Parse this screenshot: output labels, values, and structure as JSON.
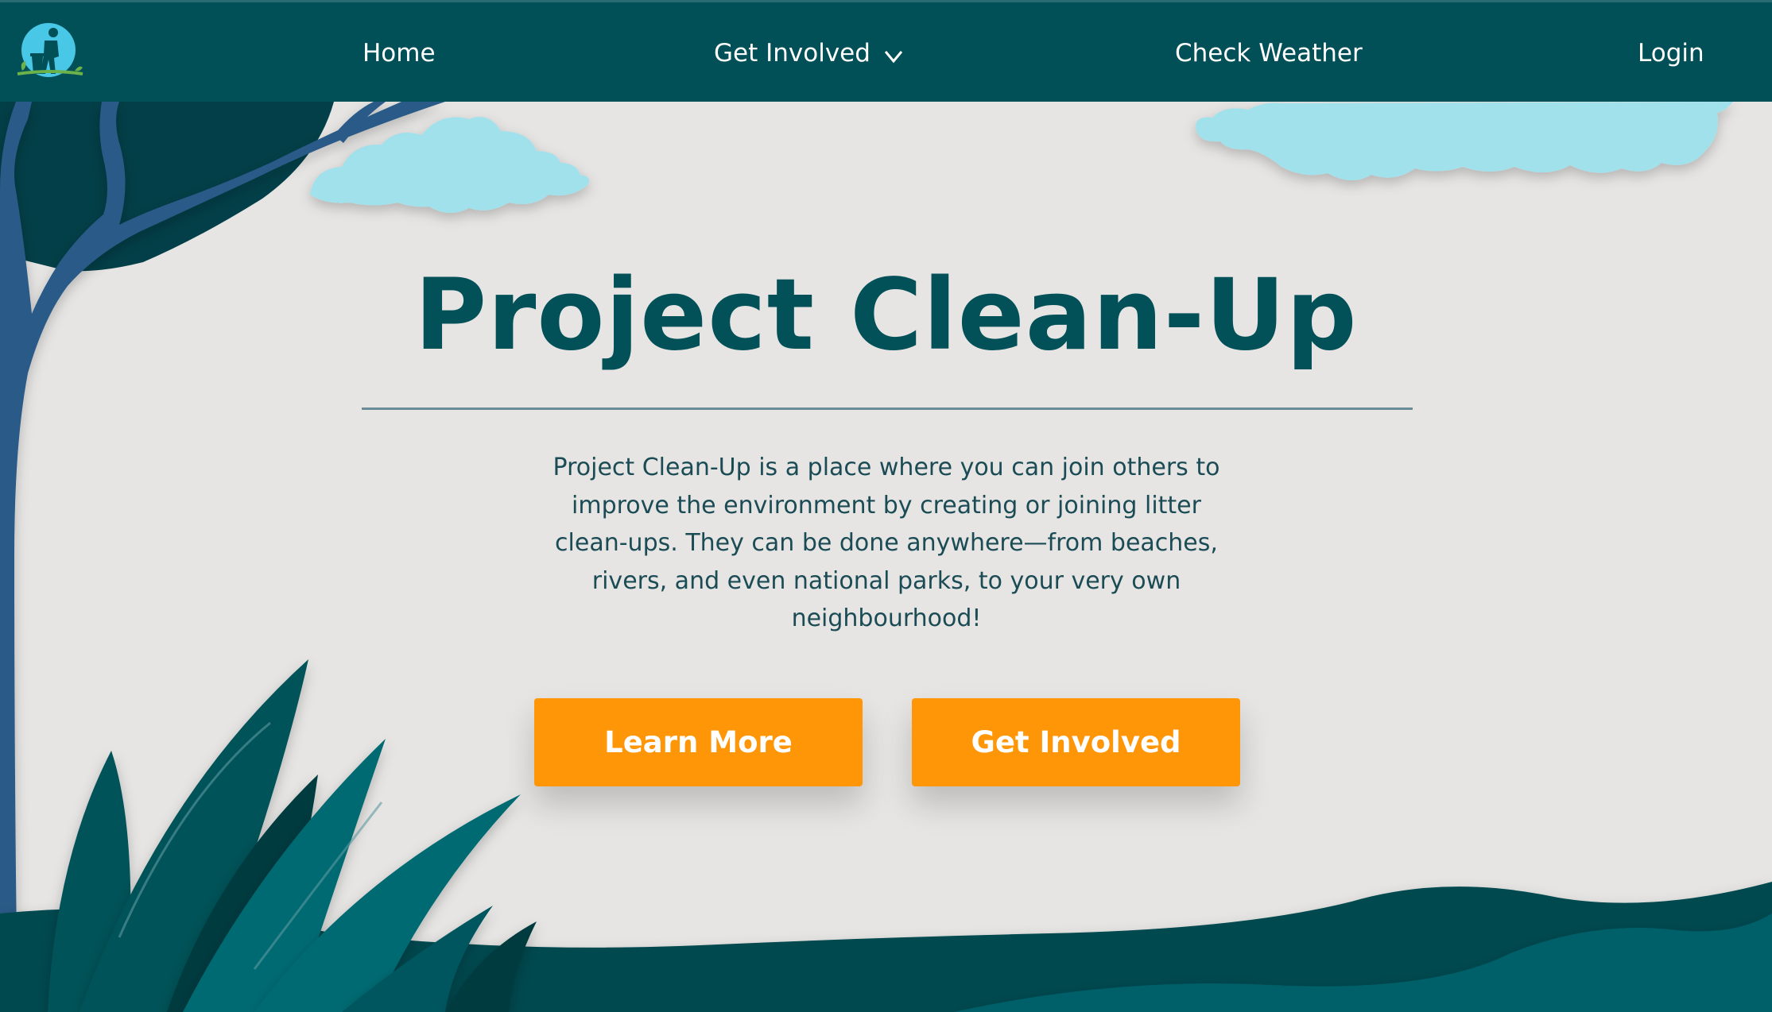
{
  "nav": {
    "logo_icon": "person-with-trash-bin-logo",
    "links": [
      {
        "label": "Home"
      },
      {
        "label": "Get Involved",
        "icon": "chevron-down-icon"
      },
      {
        "label": "Check Weather"
      },
      {
        "label": "Login"
      }
    ]
  },
  "hero": {
    "title": "Project Clean-Up",
    "description": "Project Clean-Up is a place where you can join others to improve the environment by creating or joining litter clean-ups. They can be done anywhere—from beaches, rivers, and even national parks, to your very own neighbourhood!",
    "buttons": {
      "learn_more": "Learn More",
      "get_involved": "Get Involved"
    }
  },
  "colors": {
    "nav_bg": "#014f57",
    "page_bg": "#e6e5e3",
    "accent_orange": "#ff9608",
    "title_teal": "#025058",
    "cloud": "#a1e1ec",
    "tree": "#2b5a87"
  }
}
